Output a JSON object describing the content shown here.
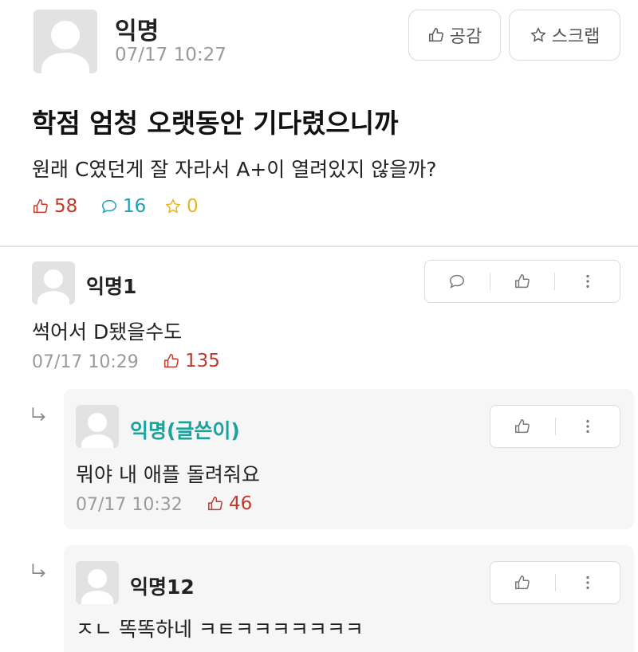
{
  "post": {
    "author": "익명",
    "time": "07/17 10:27",
    "like_button": "공감",
    "scrap_button": "스크랩",
    "title": "학점 엄청 오랫동안 기다렸으니까",
    "body": "원래 C였던게 잘 자라서 A+이 열려있지 않을까?",
    "likes": "58",
    "comments": "16",
    "scraps": "0"
  },
  "comments": [
    {
      "author": "익명1",
      "text": "썩어서 D됐을수도",
      "time": "07/17 10:29",
      "likes": "135"
    }
  ],
  "replies": [
    {
      "author": "익명(글쓴이)",
      "text": "뭐야 내 애플 돌려줘요",
      "time": "07/17 10:32",
      "likes": "46"
    },
    {
      "author": "익명12",
      "text": "ㅈㄴ 똑똑하네 ㅋㅌㅋㅋㅋㅋㅋㅋㅋ"
    }
  ],
  "colors": {
    "like_red": "#c0392b",
    "comment_cyan": "#17a2b8",
    "scrap_yellow": "#e6b422",
    "op_teal": "#1aa39a",
    "meta_gray": "#9a9a9a"
  }
}
